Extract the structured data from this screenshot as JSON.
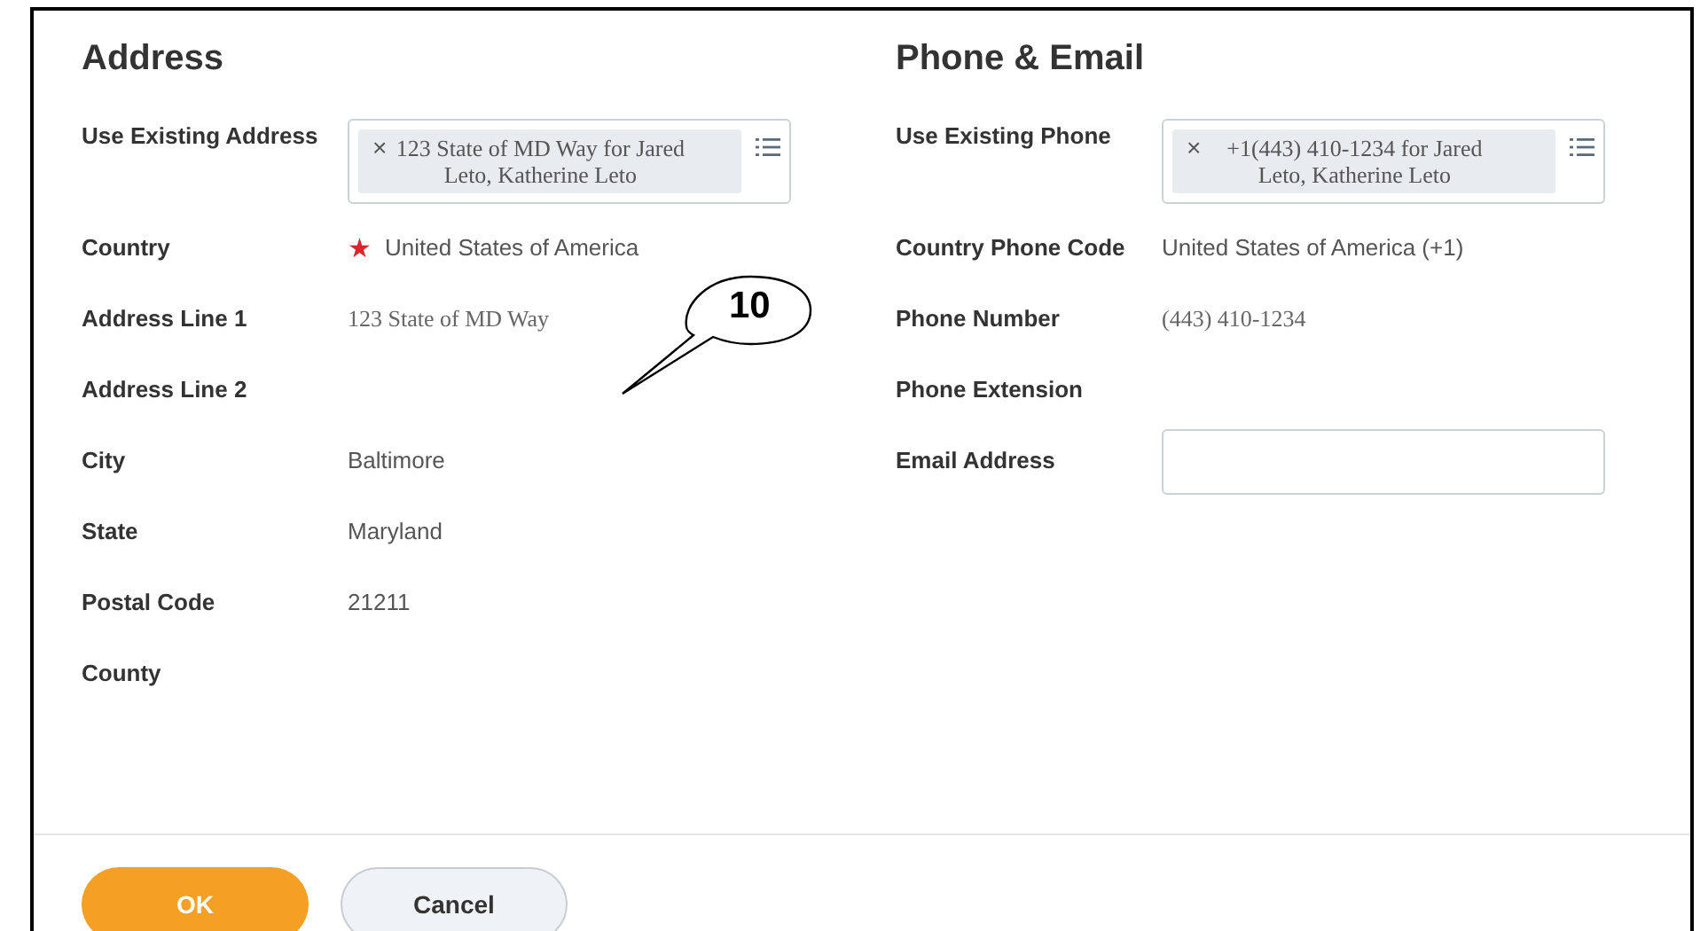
{
  "sections": [
    {
      "title": "Address",
      "fields": [
        {
          "label": "Use Existing Address",
          "kind": "chip",
          "value": "123 State of MD Way for Jared Leto, Katherine Leto",
          "remove": "×"
        },
        {
          "label": "Country",
          "kind": "text",
          "value": "United States of America",
          "required_mark": "★"
        },
        {
          "label": "Address Line 1",
          "kind": "serif",
          "value": "123 State of MD Way"
        },
        {
          "label": "Address Line 2",
          "kind": "empty"
        },
        {
          "label": "City",
          "kind": "text",
          "value": "Baltimore"
        },
        {
          "label": "State",
          "kind": "text",
          "value": "Maryland"
        },
        {
          "label": "Postal Code",
          "kind": "text",
          "value": "21211"
        },
        {
          "label": "County",
          "kind": "empty"
        }
      ]
    },
    {
      "title": "Phone & Email",
      "fields": [
        {
          "label": "Use Existing Phone",
          "kind": "chip",
          "value": "+1(443) 410-1234 for Jared Leto, Katherine Leto",
          "remove": "×"
        },
        {
          "label": "Country Phone Code",
          "kind": "text",
          "value": "United States of America (+1)"
        },
        {
          "label": "Phone Number",
          "kind": "serif",
          "value": "(443) 410-1234"
        },
        {
          "label": "Phone Extension",
          "kind": "empty"
        },
        {
          "label": "Email Address",
          "kind": "input"
        }
      ]
    }
  ],
  "callout": {
    "label": "10"
  },
  "buttons": [
    {
      "label": "OK",
      "kind": "primary"
    },
    {
      "label": "Cancel",
      "kind": "secondary"
    }
  ]
}
